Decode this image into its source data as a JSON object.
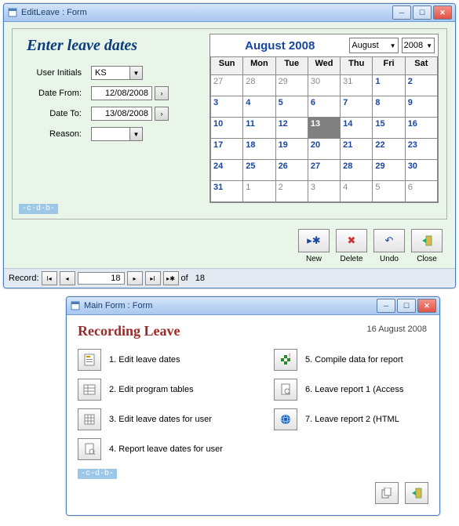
{
  "window1": {
    "title": "EditLeave : Form",
    "heading": "Enter leave dates",
    "form": {
      "user_initials_label": "User Initials",
      "user_initials_value": "KS",
      "date_from_label": "Date From:",
      "date_from_value": "12/08/2008",
      "date_to_label": "Date To:",
      "date_to_value": "13/08/2008",
      "reason_label": "Reason:",
      "reason_value": ""
    },
    "calendar": {
      "title": "August 2008",
      "month_select": "August",
      "year_select": "2008",
      "weekdays": [
        "Sun",
        "Mon",
        "Tue",
        "Wed",
        "Thu",
        "Fri",
        "Sat"
      ],
      "rows": [
        [
          {
            "d": "27",
            "t": "inactive"
          },
          {
            "d": "28",
            "t": "inactive"
          },
          {
            "d": "29",
            "t": "inactive"
          },
          {
            "d": "30",
            "t": "inactive"
          },
          {
            "d": "31",
            "t": "inactive"
          },
          {
            "d": "1",
            "t": "active"
          },
          {
            "d": "2",
            "t": "active"
          }
        ],
        [
          {
            "d": "3",
            "t": "active"
          },
          {
            "d": "4",
            "t": "active"
          },
          {
            "d": "5",
            "t": "active"
          },
          {
            "d": "6",
            "t": "active"
          },
          {
            "d": "7",
            "t": "active"
          },
          {
            "d": "8",
            "t": "active"
          },
          {
            "d": "9",
            "t": "active"
          }
        ],
        [
          {
            "d": "10",
            "t": "active"
          },
          {
            "d": "11",
            "t": "active"
          },
          {
            "d": "12",
            "t": "active"
          },
          {
            "d": "13",
            "t": "selected"
          },
          {
            "d": "14",
            "t": "active"
          },
          {
            "d": "15",
            "t": "active"
          },
          {
            "d": "16",
            "t": "active"
          }
        ],
        [
          {
            "d": "17",
            "t": "active"
          },
          {
            "d": "18",
            "t": "active"
          },
          {
            "d": "19",
            "t": "active"
          },
          {
            "d": "20",
            "t": "active"
          },
          {
            "d": "21",
            "t": "active"
          },
          {
            "d": "22",
            "t": "active"
          },
          {
            "d": "23",
            "t": "active"
          }
        ],
        [
          {
            "d": "24",
            "t": "active"
          },
          {
            "d": "25",
            "t": "active"
          },
          {
            "d": "26",
            "t": "active"
          },
          {
            "d": "27",
            "t": "active"
          },
          {
            "d": "28",
            "t": "active"
          },
          {
            "d": "29",
            "t": "active"
          },
          {
            "d": "30",
            "t": "active"
          }
        ],
        [
          {
            "d": "31",
            "t": "active"
          },
          {
            "d": "1",
            "t": "inactive"
          },
          {
            "d": "2",
            "t": "inactive"
          },
          {
            "d": "3",
            "t": "inactive"
          },
          {
            "d": "4",
            "t": "inactive"
          },
          {
            "d": "5",
            "t": "inactive"
          },
          {
            "d": "6",
            "t": "inactive"
          }
        ]
      ]
    },
    "buttons": {
      "new": "New",
      "delete": "Delete",
      "undo": "Undo",
      "close": "Close"
    },
    "cdb": "-c-d-b-",
    "record": {
      "label": "Record:",
      "current": "18",
      "of": "of",
      "total": "18"
    }
  },
  "window2": {
    "title": "Main Form : Form",
    "heading": "Recording Leave",
    "date": "16 August 2008",
    "items_left": [
      "1. Edit leave dates",
      "2. Edit program tables",
      "3. Edit leave dates for user",
      "4. Report leave dates for user"
    ],
    "items_right": [
      "5. Compile data for report",
      "6. Leave report 1 (Access",
      "7. Leave report 2 (HTML"
    ],
    "cdb": "-c-d-b-"
  }
}
